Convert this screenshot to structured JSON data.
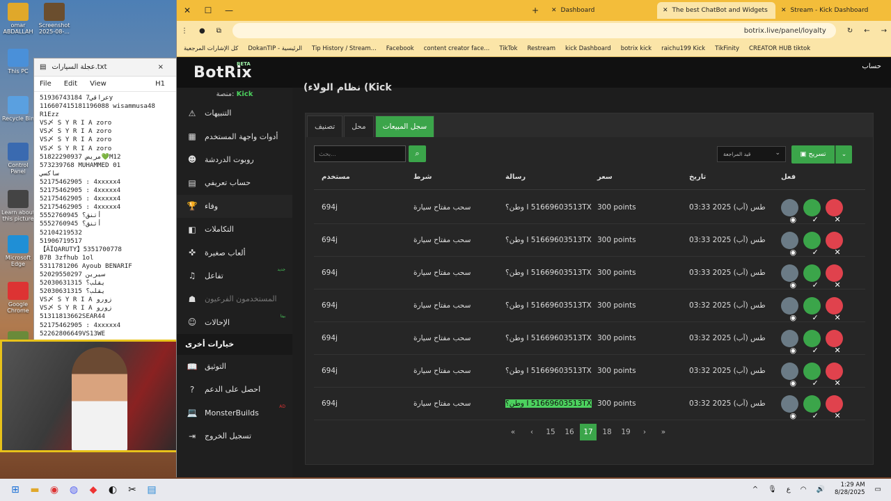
{
  "desktop": {
    "icons": [
      {
        "label": "omar ABDALLAH"
      },
      {
        "label": "This PC"
      },
      {
        "label": "Recycle Bin"
      },
      {
        "label": "Control Panel"
      },
      {
        "label": "Learn about this picture"
      },
      {
        "label": "Microsoft Edge"
      },
      {
        "label": "Google Chrome"
      },
      {
        "label": "Internet Downlo..."
      }
    ],
    "icon2": {
      "label": "Screenshot 2025-08-..."
    }
  },
  "notepad": {
    "title": "عجلة السيارات.txt",
    "heading": "H1",
    "menu": [
      "File",
      "Edit",
      "View"
    ],
    "lines": [
      "51936743184 عراقي7y",
      "116607415181196088 wisammusa48",
      "R1Ezz",
      "VS〆 S Y R I A zoro",
      "VS〆 S Y R I A zoro",
      "VS〆 S Y R I A zoro",
      "VS〆 S Y R I A zoro",
      "51822290937 مريض💚M12",
      "573239768 MUHAMMED 01",
      "ساكسي",
      "52175462905 : 4xxxxx4",
      "52175462905 : 4xxxxx4",
      "52175462905 : 4xxxxx4",
      "52175462905 : 4xxxxx4",
      "5552760945 أتنق؟",
      "5552760945 أتنق؟",
      "52104219532",
      "51906719517",
      "【ÂÏQARUTY】5351700778",
      "B7B 3zfhub 1ol",
      "5311781206 Ayoub BENARIF",
      "52029550297 سيرين",
      "52030631315 يقلب؟",
      "52030631315 يقلب؟",
      "VS〆 S Y R I A زورو",
      "VS〆 S Y R I A زورو",
      "51311813662SEAR44",
      "52175462905 : 4xxxxx4",
      "52262806649VS13WE"
    ]
  },
  "browser": {
    "tabs": [
      {
        "title": "Dashboard"
      },
      {
        "title": "The best ChatBot and Widgets"
      },
      {
        "title": "Stream - Kick Dashboard"
      }
    ],
    "url": "botrix.live/panel/loyalty",
    "bookmarks": [
      "كل الإشارات المرجعية",
      "DokanTIP - الرئيسية",
      "Tip History / Stream...",
      "Facebook",
      "content creator face...",
      "TikTok",
      "Restream",
      "kick Dashboard",
      "botrix kick",
      "raichu199 Kick",
      "TikFinity",
      "CREATOR HUB tiktok"
    ]
  },
  "app": {
    "logo": "BotRix",
    "beta": "BETA",
    "account": "حساب",
    "platform_label": "منصة:",
    "platform": "Kick",
    "title": "(نظام الولاء (Kick",
    "nav": [
      {
        "label": "التنبيهات",
        "icon": "bell-icon",
        "glyph": "⚠"
      },
      {
        "label": "أدوات واجهة المستخدم",
        "icon": "widgets-icon",
        "glyph": "▦"
      },
      {
        "label": "روبوت الدردشة",
        "icon": "robot-icon",
        "glyph": "☻"
      },
      {
        "label": "حساب تعريفي",
        "icon": "id-card-icon",
        "glyph": "▤"
      },
      {
        "label": "وفاء",
        "icon": "trophy-icon",
        "glyph": "🏆"
      },
      {
        "label": "التكاملات",
        "icon": "integrations-icon",
        "glyph": "◧"
      },
      {
        "label": "ألعاب صغيرة",
        "icon": "gamepad-icon",
        "glyph": "✜"
      },
      {
        "label": "تفاعل",
        "icon": "music-icon",
        "glyph": "♫",
        "badge": "جديد"
      },
      {
        "label": "المستخدمون الفرعيون",
        "icon": "users-icon",
        "glyph": "☗"
      },
      {
        "label": "الإحالات",
        "icon": "referrals-icon",
        "glyph": "☺",
        "badge": "بيتا"
      }
    ],
    "other_heading": "خيارات أخرى",
    "other": [
      {
        "label": "التوثيق",
        "icon": "docs-icon",
        "glyph": "📖"
      },
      {
        "label": "احصل على الدعم",
        "icon": "help-icon",
        "glyph": "?"
      },
      {
        "label": "MonsterBuilds",
        "icon": "laptop-icon",
        "glyph": "💻",
        "badge": "AD"
      },
      {
        "label": "تسجيل الخروج",
        "icon": "logout-icon",
        "glyph": "⇥"
      }
    ],
    "tabs": [
      "تصنيف",
      "محل",
      "سجل المبيعات"
    ],
    "search_placeholder": "بحث...",
    "filter": "قيد المراجعة",
    "export": "تسريح",
    "columns": [
      "مستخدم",
      "شرط",
      "رسالة",
      "سعر",
      "تاريخ",
      "فعل"
    ],
    "rows": [
      {
        "user": "694j",
        "condition": "سحب مفتاح سيارة",
        "message": "وطن؟ I 51669603513TX",
        "price": "300 points",
        "date": "طس (آب) 2025 03:33"
      },
      {
        "user": "694j",
        "condition": "سحب مفتاح سيارة",
        "message": "وطن؟ I 51669603513TX",
        "price": "300 points",
        "date": "طس (آب) 2025 03:33"
      },
      {
        "user": "694j",
        "condition": "سحب مفتاح سيارة",
        "message": "وطن؟ I 51669603513TX",
        "price": "300 points",
        "date": "طس (آب) 2025 03:33"
      },
      {
        "user": "694j",
        "condition": "سحب مفتاح سيارة",
        "message": "وطن؟ I 51669603513TX",
        "price": "300 points",
        "date": "طس (آب) 2025 03:32"
      },
      {
        "user": "694j",
        "condition": "سحب مفتاح سيارة",
        "message": "وطن؟ I 51669603513TX",
        "price": "300 points",
        "date": "طس (آب) 2025 03:32"
      },
      {
        "user": "694j",
        "condition": "سحب مفتاح سيارة",
        "message": "وطن؟ I 51669603513TX",
        "price": "300 points",
        "date": "طس (آب) 2025 03:32"
      },
      {
        "user": "694j",
        "condition": "سحب مفتاح سيارة",
        "message": "وطن؟ I 51669603513TX",
        "price": "300 points",
        "date": "طس (آب) 2025 03:32"
      }
    ],
    "pages": [
      "15",
      "16",
      "17",
      "18",
      "19"
    ],
    "current_page": "17"
  },
  "taskbar": {
    "time": "1:29 AM",
    "date": "8/28/2025",
    "lang": "ع"
  },
  "colors": {
    "accent": "#3ba54a",
    "danger": "#e0424d",
    "browser": "#f3bd3a"
  }
}
